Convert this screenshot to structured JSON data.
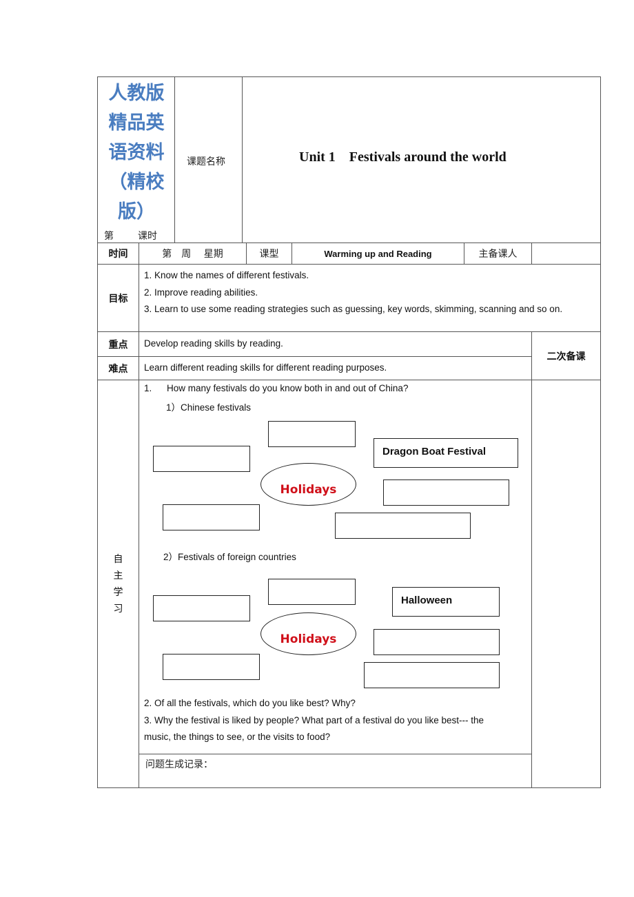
{
  "header": {
    "brand_lines": [
      "人教版",
      "精品英",
      "语资料",
      "（精校",
      "版）"
    ],
    "lesson_prefix": "第",
    "lesson_suffix": "课时",
    "topic_label": "课题名称",
    "topic_title": "Unit 1    Festivals around the world"
  },
  "info_row": {
    "time_label": "时间",
    "week_day": "第　周　 星期",
    "type_label": "课型",
    "type_value": "Warming up and Reading",
    "teacher_label": "主备课人",
    "teacher_value": ""
  },
  "goals": {
    "label": "目标",
    "items": [
      "1. Know the names of different festivals.",
      "2. Improve reading abilities.",
      "3. Learn to use some reading strategies such as guessing, key words, skimming, scanning and so on."
    ]
  },
  "key_point": {
    "label": "重点",
    "text": "Develop reading skills by reading."
  },
  "difficulty": {
    "label": "难点",
    "text": "Learn different reading skills for different reading purposes."
  },
  "second_prep_label": "二次备课",
  "self_study": {
    "label": [
      "自",
      "主",
      "学",
      "习"
    ],
    "q1": {
      "num": "1.",
      "text": "How many festivals do you know both in and out of China?"
    },
    "chinese": {
      "heading": "1）Chinese festivals",
      "center": "Holidays",
      "boxes": [
        "",
        "",
        "Dragon Boat Festival",
        "",
        "",
        ""
      ]
    },
    "foreign": {
      "heading": "2）Festivals of foreign countries",
      "center": "Holidays",
      "boxes": [
        "",
        "",
        "Halloween",
        "",
        "",
        ""
      ]
    },
    "q2": "2. Of all the festivals, which do you like best? Why?",
    "q3_line1": "3. Why the festival is liked by people? What part of a festival do you like best--- the",
    "q3_line2": "music, the things to see, or the visits to food?",
    "record_label": "问题生成记录："
  }
}
